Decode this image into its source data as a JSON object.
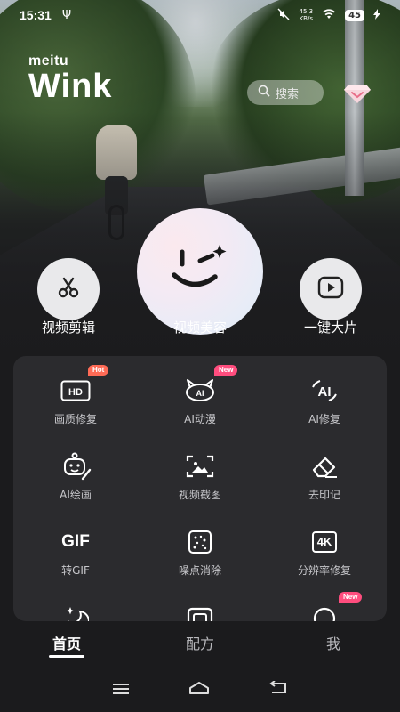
{
  "status_bar": {
    "time": "15:31",
    "net_speed_value": "45.3",
    "net_speed_unit": "KB/s",
    "battery": "45"
  },
  "brand": {
    "sub": "meitu",
    "name": "Wink"
  },
  "search": {
    "placeholder": "搜索"
  },
  "main_actions": [
    {
      "label": "视频剪辑",
      "icon": "scissors-icon"
    },
    {
      "label": "视频美容",
      "icon": "wink-face-icon"
    },
    {
      "label": "一键大片",
      "icon": "play-icon"
    }
  ],
  "tools": [
    {
      "label": "画质修复",
      "icon": "hd-icon",
      "badge": "Hot"
    },
    {
      "label": "AI动漫",
      "icon": "ai-anime-icon",
      "badge": "New"
    },
    {
      "label": "AI修复",
      "icon": "ai-repair-icon"
    },
    {
      "label": "AI绘画",
      "icon": "ai-paint-icon"
    },
    {
      "label": "视频截图",
      "icon": "screenshot-icon"
    },
    {
      "label": "去印记",
      "icon": "eraser-icon"
    },
    {
      "label": "转GIF",
      "icon": "gif-icon",
      "icon_text": "GIF"
    },
    {
      "label": "噪点消除",
      "icon": "denoise-icon"
    },
    {
      "label": "分辨率修复",
      "icon": "4k-icon",
      "icon_text": "4K"
    },
    {
      "label": "",
      "icon": "sparkle-moon-icon"
    },
    {
      "label": "",
      "icon": "frame-icon"
    },
    {
      "label": "",
      "icon": "circle-icon",
      "badge": "New"
    }
  ],
  "bottom_nav": [
    {
      "label": "首页",
      "active": true
    },
    {
      "label": "配方",
      "active": false
    },
    {
      "label": "我",
      "active": false
    }
  ],
  "colors": {
    "background": "#1b1b1d",
    "panel": "#2b2b2e",
    "hot_badge": "#ff6b56",
    "new_badge": "#ff4d7e"
  }
}
